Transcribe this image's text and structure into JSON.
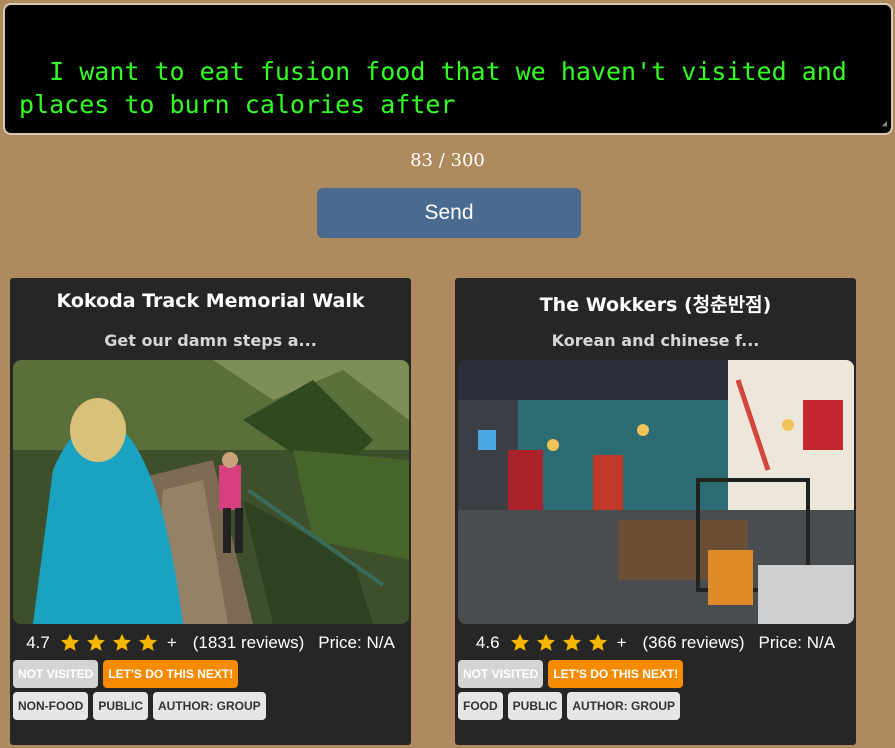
{
  "prompt": {
    "value": "I want to eat fusion food that we haven't visited and places to burn calories after",
    "char_count": "83 / 300"
  },
  "send_label": "Send",
  "cards": [
    {
      "title": "Kokoda Track Memorial Walk",
      "description": "Get our damn steps a...",
      "rating": "4.7",
      "stars": 4,
      "plus": "+",
      "reviews": "(1831 reviews)",
      "price": "Price: N/A",
      "status_tags": [
        "NOT VISITED",
        "LET'S DO THIS NEXT!"
      ],
      "info_tags": [
        "NON-FOOD",
        "PUBLIC",
        "AUTHOR: GROUP"
      ]
    },
    {
      "title": "The Wokkers (청춘반점)",
      "description": "Korean and chinese f...",
      "rating": "4.6",
      "stars": 4,
      "plus": "+",
      "reviews": "(366 reviews)",
      "price": "Price: N/A",
      "status_tags": [
        "NOT VISITED",
        "LET'S DO THIS NEXT!"
      ],
      "info_tags": [
        "FOOD",
        "PUBLIC",
        "AUTHOR: GROUP"
      ]
    }
  ],
  "colors": {
    "background": "#ad8b5f",
    "prompt_text": "#33ff22",
    "send_button": "#4b6a8f",
    "card": "#262626",
    "star": "#f7b500",
    "tag_next": "#f68b00"
  },
  "icons": [
    "star-icon",
    "resize-grip-icon"
  ]
}
